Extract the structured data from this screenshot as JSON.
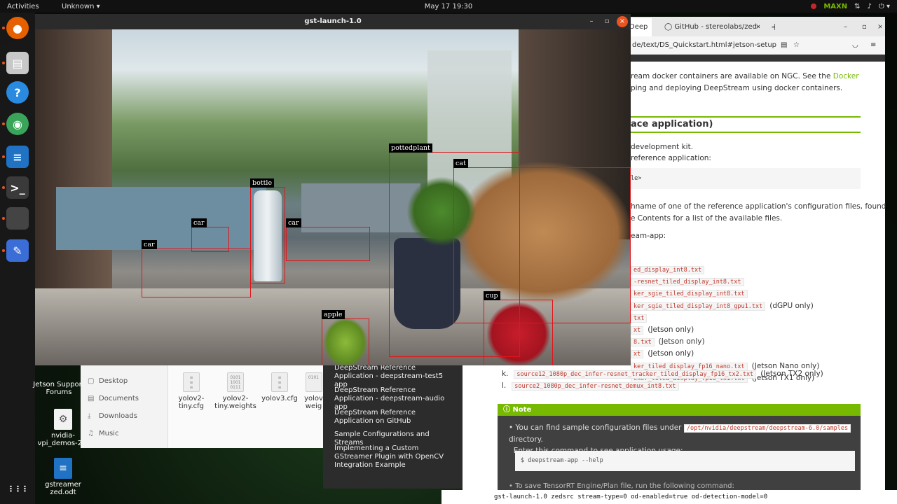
{
  "topbar": {
    "activities": "Activities",
    "app_menu": "Unknown ▾",
    "clock": "May 17  19:30",
    "nvidia": "MAXN",
    "power": "⏻ ▾"
  },
  "dock": {
    "icons": [
      {
        "name": "firefox-icon",
        "glyph": "●",
        "color": "#e66000"
      },
      {
        "name": "files-icon",
        "glyph": "▤",
        "color": "#c8c8c8"
      },
      {
        "name": "help-icon",
        "glyph": "?",
        "color": "#2a8ae0"
      },
      {
        "name": "color-icon",
        "glyph": "◉",
        "color": "#3aa55a"
      },
      {
        "name": "writer-icon",
        "glyph": "≡",
        "color": "#1f72c4"
      },
      {
        "name": "terminal-icon",
        "glyph": ">_",
        "color": "#3a3a3a"
      },
      {
        "name": "blank-app-icon",
        "glyph": "",
        "color": "#444"
      },
      {
        "name": "text-editor-icon",
        "glyph": "✎",
        "color": "#3b6dd6"
      },
      {
        "name": "app-grid-icon",
        "glyph": "⋮⋮⋮",
        "color": "transparent"
      }
    ]
  },
  "desktop": {
    "icon1_label": "Jetson Support Forums",
    "icon2_label": "nvidia-vpi_demos-2.0",
    "icon3_label": "gstreamer zed.odt"
  },
  "files": {
    "sidebar": [
      "Desktop",
      "Documents",
      "Downloads",
      "Music"
    ],
    "files": [
      {
        "name": "yolov2-tiny.cfg"
      },
      {
        "name": "yolov2-tiny.weights"
      },
      {
        "name": "yolov3.cfg"
      },
      {
        "name": "yolov weig"
      }
    ]
  },
  "gst": {
    "title": "gst-launch-1.0",
    "min": "–",
    "max": "▫",
    "close": "×"
  },
  "detections": [
    {
      "label": "pottedplant"
    },
    {
      "label": "cat"
    },
    {
      "label": "bottle"
    },
    {
      "label": "car"
    },
    {
      "label": "car"
    },
    {
      "label": "car"
    },
    {
      "label": "cup"
    },
    {
      "label": "apple"
    }
  ],
  "browser": {
    "tab1": "Deep",
    "tab1_close": "×",
    "tab2": "GitHub - stereolabs/zed-",
    "tab2_close": "×",
    "new_tab": "+",
    "url": "de/text/DS_Quickstart.html#jetson-setup",
    "para1a": "ream docker containers are available on NGC. See the",
    "para1_link": "Docker",
    "para1b": "ping and deploying DeepStream using docker containers.",
    "heading": "ace application)",
    "li1": "development kit.",
    "li2": "reference application:",
    "code_box": "le>",
    "para2a": "hname of one of the reference application's configuration files, found",
    "para2b": "e Contents for a list of the available files.",
    "para3": "eam-app:",
    "configs": [
      {
        "code": "ed_display_int8.txt",
        "suffix": ""
      },
      {
        "code": "-resnet_tiled_display_int8.txt",
        "suffix": ""
      },
      {
        "code": "ker_sgie_tiled_display_int8.txt",
        "suffix": ""
      },
      {
        "code": "ker_sgie_tiled_display_int8_gpu1.txt",
        "suffix": "(dGPU only)"
      },
      {
        "code": "txt",
        "suffix": ""
      },
      {
        "code": "xt",
        "suffix": "(Jetson only)"
      },
      {
        "code": "8.txt",
        "suffix": "(Jetson only)"
      },
      {
        "code": "xt",
        "suffix": "(Jetson only)"
      },
      {
        "code": "ker_tiled_display_fp16_nano.txt",
        "suffix": "(Jetson Nano only)"
      },
      {
        "code": "cker_tiled_display_fp16_tx1.txt",
        "suffix": "(Jetson TX1 only)"
      },
      {
        "code": "source12_1080p_dec_infer-resnet_tracker_tiled_display_fp16_tx2.txt",
        "suffix": "(Jetson TX2 only)",
        "letter": "k."
      },
      {
        "code": "source2_1080p_dec_infer-resnet_demux_int8.txt",
        "suffix": "",
        "letter": "l."
      }
    ]
  },
  "docnav": {
    "items": [
      "DeepStream Reference Application - deepstream-test5 app",
      "DeepStream Reference Application - deepstream-audio app",
      "DeepStream Reference Application on GitHub",
      "Sample Configurations and Streams",
      "Implementing a Custom GStreamer Plugin with OpenCV Integration Example"
    ]
  },
  "note": {
    "title": "Note",
    "text_a": "You can find sample configuration files under",
    "path": "/opt/nvidia/deepstream/deepstream-6.0/samples",
    "text_b": "directory.",
    "text_c": "Enter this command to see application usage:",
    "command": "$ deepstream-app --help",
    "cut_text": "To save TensorRT Engine/Plan file, run the following command:"
  },
  "terminal": {
    "line": "gst-launch-1.0      zedsrc stream-type=0 od-enabled=true od-detection-model=0"
  }
}
